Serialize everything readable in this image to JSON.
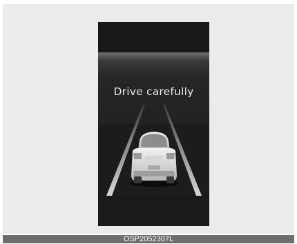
{
  "display": {
    "message": "Drive carefully"
  },
  "figure": {
    "code": "OSP2052307L"
  },
  "icons": {
    "vehicle": "car-rear-icon",
    "lanes": "lane-lines-icon"
  },
  "colors": {
    "screen_background": "#1c1c1c",
    "text": "#ededed",
    "caption_bar": "#6e6e6e"
  }
}
